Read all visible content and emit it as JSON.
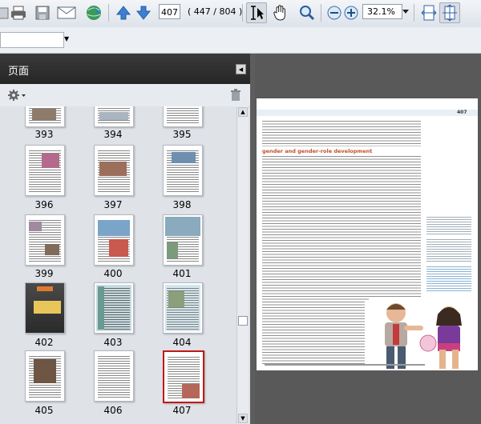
{
  "toolbar": {
    "current_page": "407",
    "page_total": "( 447 / 804 )",
    "zoom": "32.1%",
    "icons": [
      "print-icon",
      "save-icon",
      "email-icon",
      "internet-icon",
      "previous-page-icon",
      "next-page-icon",
      "select-tool-icon",
      "hand-tool-icon",
      "zoom-tool-icon",
      "zoom-out-icon",
      "zoom-in-icon",
      "fit-width-icon",
      "fit-page-icon"
    ]
  },
  "panel": {
    "title": "页面",
    "thumbnails": [
      {
        "label": "393"
      },
      {
        "label": "394"
      },
      {
        "label": "395"
      },
      {
        "label": "396"
      },
      {
        "label": "397"
      },
      {
        "label": "398"
      },
      {
        "label": "399"
      },
      {
        "label": "400"
      },
      {
        "label": "401"
      },
      {
        "label": "402"
      },
      {
        "label": "403"
      },
      {
        "label": "404"
      },
      {
        "label": "405"
      },
      {
        "label": "406"
      },
      {
        "label": "407"
      }
    ],
    "selected_page": "407"
  },
  "document": {
    "page_number": "407",
    "section_heading": "gender and gender-role development",
    "colors": {
      "heading": "#c2502c",
      "accent": "#3b7fbf",
      "selected": "#c01818"
    }
  }
}
